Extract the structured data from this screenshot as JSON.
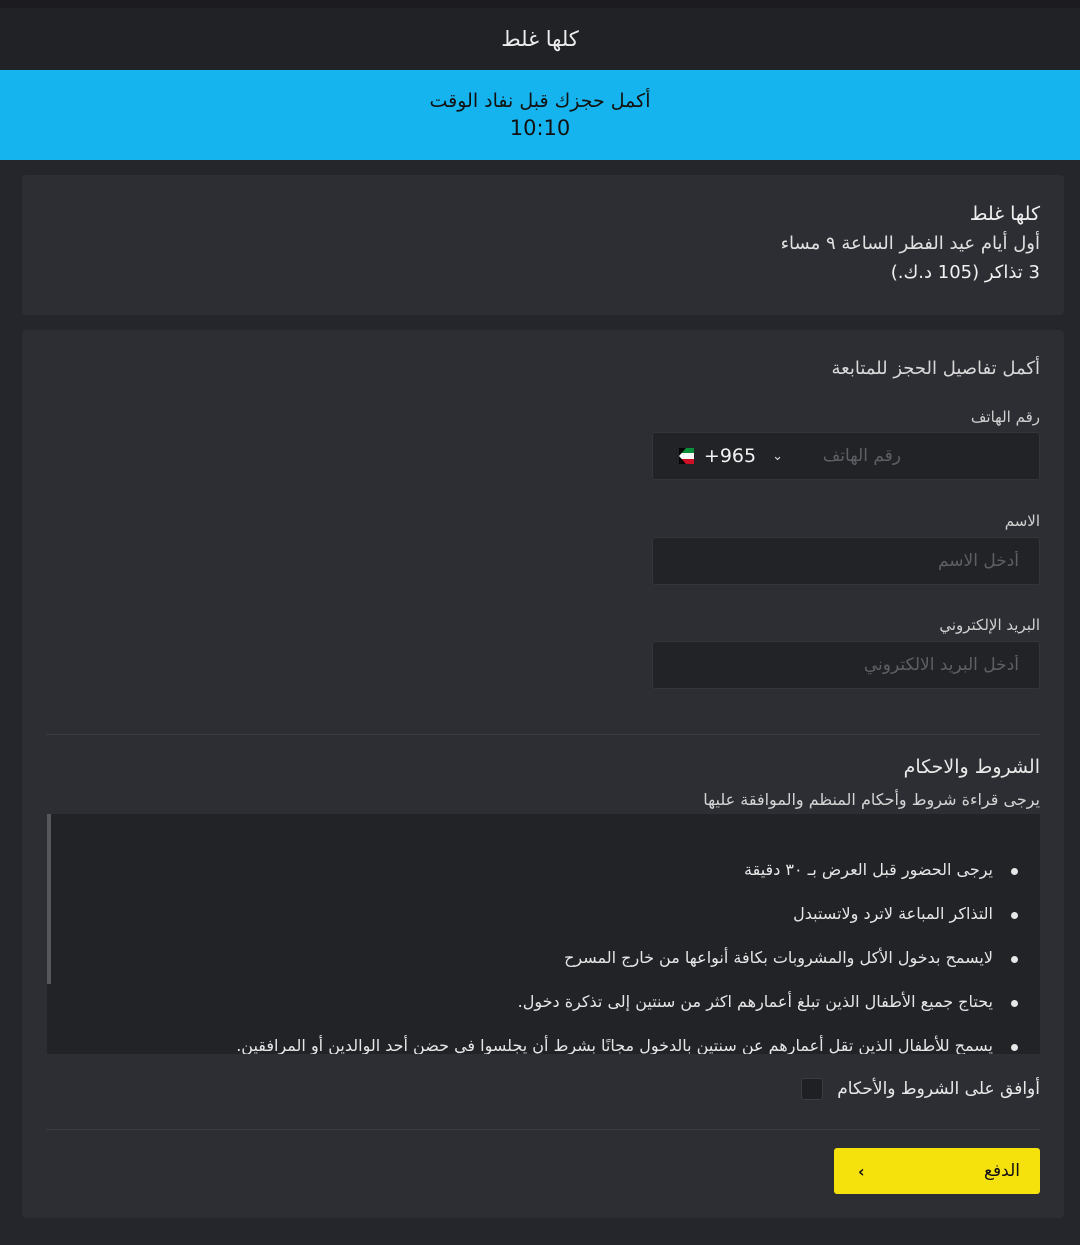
{
  "header": {
    "title": "كلها غلط"
  },
  "timer": {
    "message": "أكمل حجزك قبل نفاد الوقت",
    "time": "10:10"
  },
  "summary": {
    "event_title": "كلها غلط",
    "event_date": "أول أيام عيد الفطر الساعة ٩ مساء",
    "tickets": "3 تذاكر (105 د.ك.)"
  },
  "form": {
    "heading": "أكمل تفاصيل الحجز للمتابعة",
    "phone": {
      "label": "رقم الهاتف",
      "placeholder": "رقم الهاتف",
      "country_code": "+965",
      "country_flag": "kuwait-flag-icon"
    },
    "name": {
      "label": "الاسم",
      "placeholder": "أدخل الاسم"
    },
    "email": {
      "label": "البريد الإلكتروني",
      "placeholder": "أدخل البريد الالكتروني"
    }
  },
  "terms": {
    "title": "الشروط والاحكام",
    "subtitle": "يرجى قراءة شروط وأحكام المنظم والموافقة عليها",
    "items": [
      "يرجى الحضور قبل العرض بـ ٣٠ دقيقة",
      "التذاكر المباعة لاترد ولاتستبدل",
      "لايسمح بدخول الأكل والمشروبات بكافة أنواعها من خارج المسرح",
      "يحتاج جميع الأطفال الذين تبلغ أعمارهم اكثر من سنتين إلى تذكرة دخول.",
      "يسمح للأطفال الذين تقل أعمارهم عن سنتين بالدخول مجانًا بشرط أن يجلسوا في حضن أحد الوالدين أو المرافقين."
    ],
    "agree_label": "أوافق على الشروط والأحكام"
  },
  "actions": {
    "pay_label": "الدفع"
  },
  "colors": {
    "accent_blue": "#16b4ee",
    "pay_yellow": "#f5e20d",
    "background": "#25262b",
    "card": "#2d2e33"
  }
}
